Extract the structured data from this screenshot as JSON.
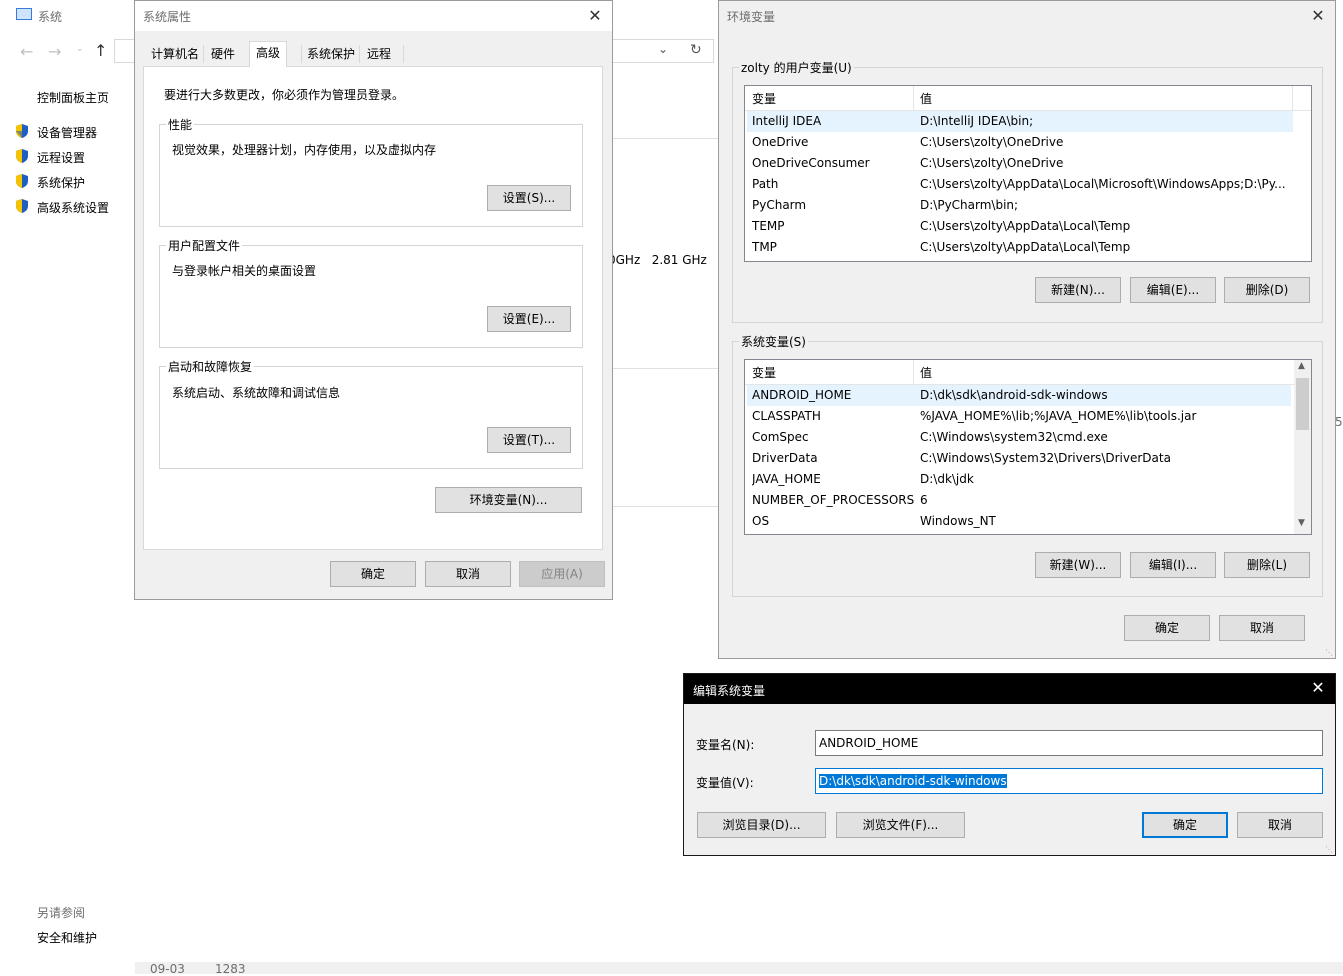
{
  "system_window": {
    "title": "系统",
    "nav_home": "控制面板主页",
    "nav_items": [
      "设备管理器",
      "远程设置",
      "系统保护",
      "高级系统设置"
    ],
    "see_also_label": "另请参阅",
    "see_also_item": "安全和维护",
    "cpu_fragment": "0GHz   2.81 GHz",
    "footer_date": "09-03",
    "footer_count": "1283",
    "side_fragment": "5"
  },
  "sysprops": {
    "title": "系统属性",
    "tabs": [
      "计算机名",
      "硬件",
      "高级",
      "系统保护",
      "远程"
    ],
    "active_tab": "高级",
    "admin_note": "要进行大多数更改，你必须作为管理员登录。",
    "groups": [
      {
        "title": "性能",
        "desc": "视觉效果，处理器计划，内存使用，以及虚拟内存",
        "button": "设置(S)..."
      },
      {
        "title": "用户配置文件",
        "desc": "与登录帐户相关的桌面设置",
        "button": "设置(E)..."
      },
      {
        "title": "启动和故障恢复",
        "desc": "系统启动、系统故障和调试信息",
        "button": "设置(T)..."
      }
    ],
    "env_button": "环境变量(N)...",
    "ok": "确定",
    "cancel": "取消",
    "apply": "应用(A)"
  },
  "envvars": {
    "title": "环境变量",
    "user_group_title": "zolty 的用户变量(U)",
    "col_var": "变量",
    "col_val": "值",
    "user_vars": [
      {
        "name": "IntelliJ IDEA",
        "value": "D:\\IntelliJ IDEA\\bin;"
      },
      {
        "name": "OneDrive",
        "value": "C:\\Users\\zolty\\OneDrive"
      },
      {
        "name": "OneDriveConsumer",
        "value": "C:\\Users\\zolty\\OneDrive"
      },
      {
        "name": "Path",
        "value": "C:\\Users\\zolty\\AppData\\Local\\Microsoft\\WindowsApps;D:\\Py..."
      },
      {
        "name": "PyCharm",
        "value": "D:\\PyCharm\\bin;"
      },
      {
        "name": "TEMP",
        "value": "C:\\Users\\zolty\\AppData\\Local\\Temp"
      },
      {
        "name": "TMP",
        "value": "C:\\Users\\zolty\\AppData\\Local\\Temp"
      }
    ],
    "user_buttons": {
      "new": "新建(N)...",
      "edit": "编辑(E)...",
      "delete": "删除(D)"
    },
    "system_group_title": "系统变量(S)",
    "system_vars": [
      {
        "name": "ANDROID_HOME",
        "value": "D:\\dk\\sdk\\android-sdk-windows"
      },
      {
        "name": "CLASSPATH",
        "value": "%JAVA_HOME%\\lib;%JAVA_HOME%\\lib\\tools.jar"
      },
      {
        "name": "ComSpec",
        "value": "C:\\Windows\\system32\\cmd.exe"
      },
      {
        "name": "DriverData",
        "value": "C:\\Windows\\System32\\Drivers\\DriverData"
      },
      {
        "name": "JAVA_HOME",
        "value": "D:\\dk\\jdk"
      },
      {
        "name": "NUMBER_OF_PROCESSORS",
        "value": "6"
      },
      {
        "name": "OS",
        "value": "Windows_NT"
      }
    ],
    "system_buttons": {
      "new": "新建(W)...",
      "edit": "编辑(I)...",
      "delete": "删除(L)"
    },
    "ok": "确定",
    "cancel": "取消"
  },
  "editvar": {
    "title": "编辑系统变量",
    "name_label": "变量名(N):",
    "name_value": "ANDROID_HOME",
    "value_label": "变量值(V):",
    "value_value": "D:\\dk\\sdk\\android-sdk-windows",
    "browse_dir": "浏览目录(D)...",
    "browse_file": "浏览文件(F)...",
    "ok": "确定",
    "cancel": "取消"
  },
  "colors": {
    "selection": "#0078d7",
    "shield_blue": "#1f5fbf",
    "shield_yellow": "#f5c400"
  }
}
